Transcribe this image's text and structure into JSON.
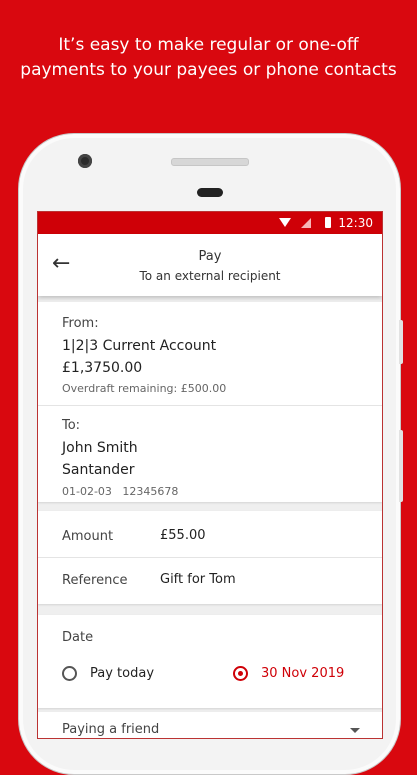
{
  "promo": {
    "line1": "It’s easy to make regular or one-off",
    "line2": "payments to your payees or phone contacts"
  },
  "status_bar": {
    "time": "12:30",
    "icons": [
      "wifi-icon",
      "signal-icon",
      "battery-icon"
    ]
  },
  "header": {
    "back_icon": "arrow-left-icon",
    "title": "Pay",
    "subtitle": "To an external recipient"
  },
  "from": {
    "label": "From:",
    "account_name": "1|2|3 Current Account",
    "balance": "£1,3750.00",
    "overdraft": "Overdraft remaining: £500.00"
  },
  "to": {
    "label": "To:",
    "name": "John Smith",
    "bank": "Santander",
    "sort_and_account": "01-02-03   12345678"
  },
  "amount": {
    "label": "Amount",
    "value": "£55.00"
  },
  "reference": {
    "label": "Reference",
    "value": "Gift for Tom"
  },
  "date": {
    "label": "Date",
    "option_today": "Pay today",
    "option_date": "30 Nov 2019",
    "selected": "option_date"
  },
  "paying": {
    "label": "Paying a friend"
  },
  "colors": {
    "brand_red": "#cf0007",
    "background_red": "#d9080f"
  }
}
